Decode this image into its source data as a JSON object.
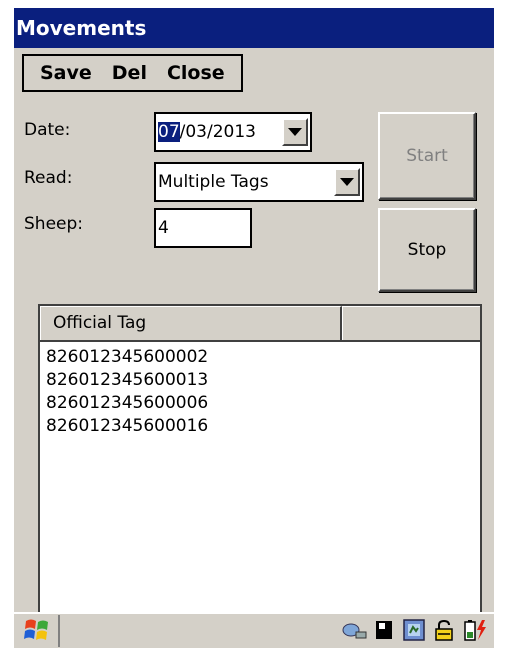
{
  "window": {
    "title": "Movements"
  },
  "menu": {
    "save": "Save",
    "del": "Del",
    "close": "Close"
  },
  "form": {
    "date_label": "Date:",
    "date_selected": "07",
    "date_rest": "/03/2013",
    "read_label": "Read:",
    "read_value": "Multiple Tags",
    "sheep_label": "Sheep:",
    "sheep_value": "4"
  },
  "buttons": {
    "start": "Start",
    "stop": "Stop"
  },
  "list": {
    "columns": [
      "Official Tag",
      ""
    ],
    "rows": [
      "826012345600002",
      "826012345600013",
      "826012345600006",
      "826012345600016"
    ]
  },
  "taskbar": {
    "icons": [
      "windows-start-icon",
      "network-icon",
      "memory-card-icon",
      "device-sync-icon",
      "lock-icon",
      "battery-charging-icon"
    ]
  }
}
